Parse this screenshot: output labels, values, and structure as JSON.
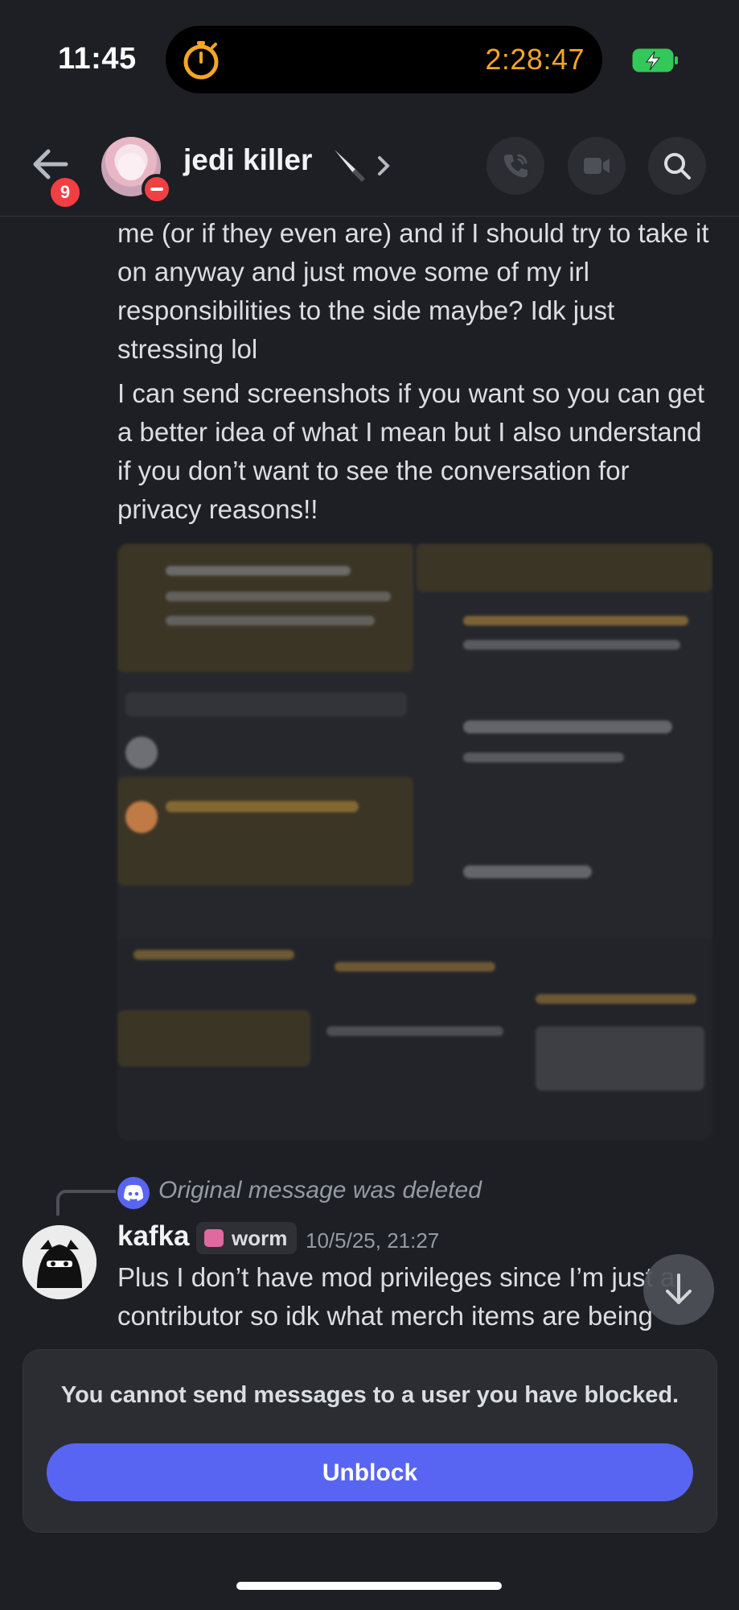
{
  "status_bar": {
    "time": "11:45",
    "timer": "2:28:47",
    "timer_color": "#f5a623",
    "battery_icon": "battery-charging-icon"
  },
  "header": {
    "back_badge": "9",
    "title": "jedi killer",
    "title_emoji_icon": "knife-icon",
    "actions": [
      "call-icon",
      "video-icon",
      "search-icon"
    ]
  },
  "messages": {
    "para1": "me (or if they even are) and if I should try to take it on anyway and just move some of my irl responsibilities to the side maybe? Idk just stressing lol",
    "para2": "I can send screenshots if you want so you can get a better idea of what I mean but I also understand if you don’t want to see the conversation for privacy reasons!!",
    "attachment": "blurred-screenshots-image"
  },
  "reply": {
    "deleted_text": "Original message was deleted",
    "author": "kafka",
    "tag": "worm",
    "timestamp": "10/5/25, 21:27",
    "text": "Plus I don’t have mod privileges since I’m just a contributor so idk what merch items are being made with the artwork that’s in each bundle or what"
  },
  "blocked_panel": {
    "message": "You cannot send messages to a user you have blocked.",
    "unblock_label": "Unblock",
    "accent": "#5865f2"
  }
}
